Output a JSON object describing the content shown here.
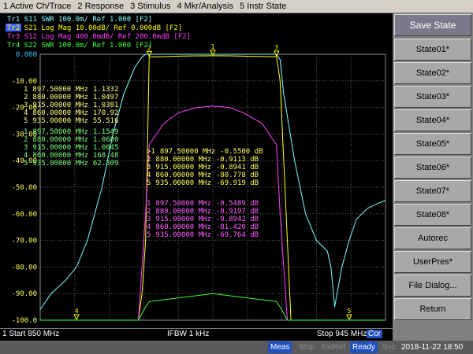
{
  "menu": [
    "1 Active Ch/Trace",
    "2 Response",
    "3 Stimulus",
    "4 Mkr/Analysis",
    "5 Instr State"
  ],
  "traces": [
    {
      "label": "Tr1 S11 SWR 100.0m/ Ref 1.000 [F2]",
      "color": "#7fffff"
    },
    {
      "label": "Tr2 S21 Log Mag 10.00dB/ Ref 0.000dB [F2]",
      "color": "#ffff00"
    },
    {
      "label": "Tr3 S12 Log Mag 400.0mdB/ Ref 200.0mdB [F2]",
      "color": "#ff40ff"
    },
    {
      "label": "Tr4 S22 SWR 100.0m/ Ref 1.000 [F2]",
      "color": "#40ff40"
    }
  ],
  "y_labels": [
    "0.000",
    "-10.00",
    "-20.00",
    "-30.00",
    "-40.00",
    "-50.00",
    "-60.00",
    "-70.00",
    "-80.00",
    "-90.00",
    "-100.0"
  ],
  "marker_tables": [
    {
      "color": "#ffff80",
      "rows": [
        {
          "n": "1",
          "freq": "897.50000 MHz",
          "val": "1.1332"
        },
        {
          "n": "2",
          "freq": "880.00000 MHz",
          "val": "1.0497"
        },
        {
          "n": "3",
          "freq": "915.00000 MHz",
          "val": "1.0381"
        },
        {
          "n": "4",
          "freq": "860.00000 MHz",
          "val": "170.92"
        },
        {
          "n": "5",
          "freq": "935.00000 MHz",
          "val": "55.516"
        }
      ]
    },
    {
      "color": "#7fff7f",
      "rows": [
        {
          "n": "1",
          "freq": "897.50000 MHz",
          "val": "1.1549"
        },
        {
          "n": "2",
          "freq": "880.00000 MHz",
          "val": "1.0680"
        },
        {
          "n": "3",
          "freq": "915.00000 MHz",
          "val": "1.0045"
        },
        {
          "n": "4",
          "freq": "860.00000 MHz",
          "val": "168.48"
        },
        {
          "n": "5",
          "freq": "935.00000 MHz",
          "val": "62.309"
        }
      ]
    },
    {
      "color": "#ffff60",
      "rows": [
        {
          "n": ">1",
          "freq": "897.50000 MHz",
          "val": "-0.5500 dB"
        },
        {
          "n": "2",
          "freq": "880.00000 MHz",
          "val": "-0.9113 dB"
        },
        {
          "n": "3",
          "freq": "915.00000 MHz",
          "val": "-0.8941 dB"
        },
        {
          "n": "4",
          "freq": "860.00000 MHz",
          "val": "-80.778 dB"
        },
        {
          "n": "5",
          "freq": "935.00000 MHz",
          "val": "-69.919 dB"
        }
      ]
    },
    {
      "color": "#ff60ff",
      "rows": [
        {
          "n": "1",
          "freq": "897.50000 MHz",
          "val": "-0.5489 dB"
        },
        {
          "n": "2",
          "freq": "880.00000 MHz",
          "val": "-0.9197 dB"
        },
        {
          "n": "3",
          "freq": "915.00000 MHz",
          "val": "-0.8942 dB"
        },
        {
          "n": "4",
          "freq": "860.00000 MHz",
          "val": "-81.420 dB"
        },
        {
          "n": "5",
          "freq": "935.00000 MHz",
          "val": "-69.764 dB"
        }
      ]
    }
  ],
  "start_label": "1  Start 850 MHz",
  "ifbw_label": "IFBW 1 kHz",
  "stop_label": "Stop 945 MHz",
  "stop_badge": "Cor",
  "softkeys": [
    "Save State",
    "State01*",
    "State02*",
    "State03*",
    "State04*",
    "State05*",
    "State06*",
    "State07*",
    "State08*",
    "Autorec",
    "UserPres*",
    "File Dialog...",
    "Return"
  ],
  "status": {
    "meas": "Meas",
    "stop": "Stop",
    "extref": "ExtRef",
    "ready": "Ready",
    "svc": "Svc",
    "datetime": "2018-11-22 18:50"
  },
  "chart_data": {
    "type": "line",
    "x_range_mhz": [
      850,
      945
    ],
    "y_range_db": [
      -100,
      0
    ],
    "grid": true,
    "series": [
      {
        "name": "S21",
        "color": "#ffff00",
        "x": [
          850,
          862,
          872,
          877,
          878,
          879,
          880,
          884,
          888,
          893,
          897.5,
          902,
          906,
          911,
          915,
          916,
          917,
          918,
          919,
          935,
          945
        ],
        "y": [
          -100,
          -100,
          -100,
          -100,
          -90,
          -70,
          -1,
          -0.9,
          -0.7,
          -0.6,
          -0.55,
          -0.6,
          -0.7,
          -0.85,
          -0.9,
          -10,
          -40,
          -70,
          -100,
          -100,
          -100
        ]
      },
      {
        "name": "S12",
        "color": "#ff40ff",
        "x": [
          850,
          877,
          878,
          879,
          880,
          884,
          888,
          893,
          897.5,
          902,
          906,
          911,
          915,
          916,
          917,
          918,
          945
        ],
        "y": [
          -100,
          -100,
          -80,
          -60,
          -34,
          -26,
          -22,
          -20,
          -19.5,
          -20,
          -22,
          -26,
          -34,
          -60,
          -80,
          -100,
          -100
        ]
      },
      {
        "name": "S11",
        "color": "#7fffff",
        "x": [
          850,
          853,
          857,
          860,
          863,
          867,
          870,
          873,
          876,
          878,
          879,
          880,
          897.5,
          915,
          916,
          917,
          920,
          923,
          926,
          929,
          930,
          931,
          933,
          935,
          937,
          940,
          943,
          945
        ],
        "y": [
          -96,
          -90,
          -85,
          -80,
          -70,
          -50,
          -30,
          -15,
          -5,
          -1,
          0,
          0,
          0,
          0,
          -2,
          -15,
          -40,
          -60,
          -70,
          -74,
          -80,
          -95,
          -80,
          -70,
          -62,
          -58,
          -56,
          -55
        ]
      },
      {
        "name": "S22",
        "color": "#40ff40",
        "x": [
          850,
          877,
          879,
          880,
          897.5,
          915,
          916,
          918,
          945
        ],
        "y": [
          -100,
          -100,
          -95,
          -93,
          -90,
          -93,
          -95,
          -100,
          -100
        ]
      }
    ],
    "markers": [
      {
        "n": "1",
        "x": 897.5,
        "trace": "S21"
      },
      {
        "n": "2",
        "x": 880,
        "trace": "S21"
      },
      {
        "n": "3",
        "x": 915,
        "trace": "S21"
      },
      {
        "n": "4",
        "x": 860,
        "trace": "S21"
      },
      {
        "n": "5",
        "x": 935,
        "trace": "S21"
      }
    ]
  }
}
